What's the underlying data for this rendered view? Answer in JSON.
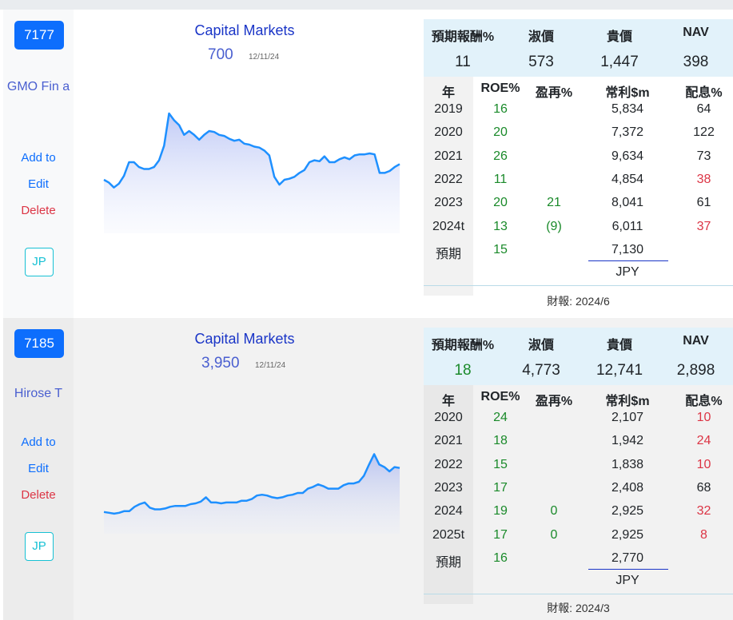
{
  "cards": [
    {
      "code": "7177",
      "name": "GMO Fin a",
      "actions": {
        "add": "Add to",
        "edit": "Edit",
        "delete": "Delete",
        "jp": "JP"
      },
      "sector": "Capital Markets",
      "price": "700",
      "date": "12/11/24",
      "valuation": {
        "headers": [
          "預期報酬%",
          "淑價",
          "貴價",
          "NAV"
        ],
        "values": [
          "11",
          "573",
          "1,447",
          "398"
        ]
      },
      "table": {
        "headers": [
          "年",
          "ROE%",
          "盈再%",
          "常利$m",
          "配息%"
        ],
        "rows": [
          [
            "2019",
            "16",
            "",
            "5,834",
            "64"
          ],
          [
            "2020",
            "20",
            "",
            "7,372",
            "122"
          ],
          [
            "2021",
            "26",
            "",
            "9,634",
            "73"
          ],
          [
            "2022",
            "11",
            "",
            "4,854",
            "38"
          ],
          [
            "2023",
            "20",
            "21",
            "8,041",
            "61"
          ],
          [
            "2024t",
            "13",
            "(9)",
            "6,011",
            "37"
          ],
          [
            "預期",
            "15",
            "",
            "7,130",
            ""
          ]
        ],
        "currency": "JPY"
      },
      "report": "財報: 2024/6",
      "spark": [
        0.32,
        0.29,
        0.24,
        0.28,
        0.36,
        0.5,
        0.5,
        0.45,
        0.43,
        0.43,
        0.45,
        0.52,
        0.67,
        1.0,
        0.93,
        0.88,
        0.78,
        0.82,
        0.78,
        0.73,
        0.78,
        0.82,
        0.81,
        0.78,
        0.77,
        0.74,
        0.72,
        0.73,
        0.69,
        0.68,
        0.66,
        0.65,
        0.62,
        0.57,
        0.35,
        0.27,
        0.32,
        0.33,
        0.35,
        0.39,
        0.42,
        0.5,
        0.52,
        0.51,
        0.56,
        0.5,
        0.5,
        0.53,
        0.55,
        0.53,
        0.57,
        0.58,
        0.58,
        0.59,
        0.58,
        0.39,
        0.39,
        0.41,
        0.45,
        0.48
      ]
    },
    {
      "code": "7185",
      "name": "Hirose T",
      "actions": {
        "add": "Add to",
        "edit": "Edit",
        "delete": "Delete",
        "jp": "JP"
      },
      "sector": "Capital Markets",
      "price": "3,950",
      "date": "12/11/24",
      "valuation": {
        "headers": [
          "預期報酬%",
          "淑價",
          "貴價",
          "NAV"
        ],
        "values": [
          "18",
          "4,773",
          "12,741",
          "2,898"
        ]
      },
      "table": {
        "headers": [
          "年",
          "ROE%",
          "盈再%",
          "常利$m",
          "配息%"
        ],
        "rows": [
          [
            "2020",
            "24",
            "",
            "2,107",
            "10"
          ],
          [
            "2021",
            "18",
            "",
            "1,942",
            "24"
          ],
          [
            "2022",
            "15",
            "",
            "1,838",
            "10"
          ],
          [
            "2023",
            "17",
            "",
            "2,408",
            "68"
          ],
          [
            "2024",
            "19",
            "0",
            "2,925",
            "32"
          ],
          [
            "2025t",
            "17",
            "0",
            "2,925",
            "8"
          ],
          [
            "預期",
            "16",
            "",
            "2,770",
            ""
          ]
        ],
        "currency": "JPY"
      },
      "report": "財報: 2024/3",
      "spark": [
        0.03,
        0.02,
        0.01,
        0.02,
        0.04,
        0.04,
        0.09,
        0.12,
        0.14,
        0.08,
        0.06,
        0.06,
        0.07,
        0.09,
        0.1,
        0.1,
        0.1,
        0.12,
        0.13,
        0.15,
        0.2,
        0.14,
        0.14,
        0.13,
        0.14,
        0.14,
        0.14,
        0.16,
        0.16,
        0.18,
        0.22,
        0.23,
        0.22,
        0.2,
        0.19,
        0.2,
        0.22,
        0.23,
        0.25,
        0.25,
        0.3,
        0.32,
        0.35,
        0.33,
        0.3,
        0.3,
        0.3,
        0.34,
        0.36,
        0.36,
        0.38,
        0.45,
        0.58,
        0.7,
        0.58,
        0.55,
        0.5,
        0.55,
        0.54
      ]
    }
  ],
  "colors": {
    "green": "#1a8a2a",
    "red": "#dc3545",
    "blue_button": "#0d6efd",
    "line": "#1e90ff"
  }
}
